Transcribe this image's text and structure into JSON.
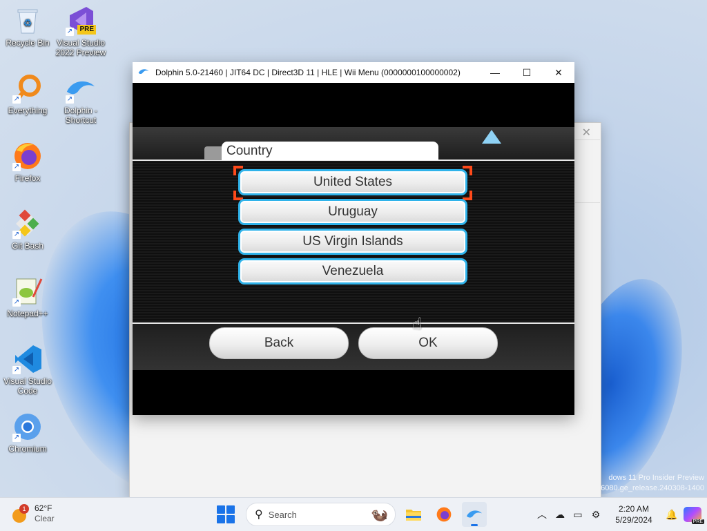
{
  "desktop": {
    "icons": [
      {
        "label": "Recycle Bin",
        "icon": "recycle-bin-icon"
      },
      {
        "label": "Visual Studio 2022 Preview",
        "icon": "visual-studio-icon",
        "badge": "PRE"
      },
      {
        "label": "Everything",
        "icon": "everything-search-icon"
      },
      {
        "label": "Dolphin - Shortcut",
        "icon": "dolphin-icon"
      },
      {
        "label": "Firefox",
        "icon": "firefox-icon"
      },
      {
        "label": "Git Bash",
        "icon": "git-bash-icon"
      },
      {
        "label": "Notepad++",
        "icon": "notepad-plus-plus-icon"
      },
      {
        "label": "Visual Studio Code",
        "icon": "vscode-icon"
      },
      {
        "label": "Chromium",
        "icon": "chromium-icon"
      }
    ],
    "watermark_line1": "dows 11 Pro Insider Preview",
    "watermark_line2": "6080.ge_release.240308-1400"
  },
  "dolphin_window": {
    "title": "Dolphin 5.0-21460 | JIT64 DC | Direct3D 11 | HLE | Wii Menu (0000000100000002)",
    "controls": {
      "minimize": "—",
      "maximize": "☐",
      "close": "✕"
    }
  },
  "wii_menu": {
    "tab_title": "Country",
    "countries": [
      "United States",
      "Uruguay",
      "US Virgin Islands",
      "Venezuela"
    ],
    "selected_index": 0,
    "back_label": "Back",
    "ok_label": "OK"
  },
  "taskbar": {
    "weather": {
      "badge": "1",
      "temperature": "62°F",
      "condition": "Clear"
    },
    "search_placeholder": "Search",
    "clock": {
      "time": "2:20 AM",
      "date": "5/29/2024"
    },
    "copilot_badge": "PRE"
  },
  "colors": {
    "selection_border": "#30b3ea",
    "selection_bracket": "#ff4a1a",
    "accent": "#1a73e8"
  }
}
